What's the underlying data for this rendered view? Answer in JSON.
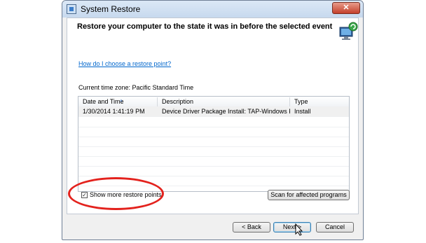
{
  "window": {
    "title": "System Restore",
    "close_glyph": "✕"
  },
  "header": {
    "text": "Restore your computer to the state it was in before the selected event"
  },
  "help_link": "How do I choose a restore point?",
  "timezone": "Current time zone: Pacific Standard Time",
  "table": {
    "columns": [
      "Date and Time",
      "Description",
      "Type"
    ],
    "rows": [
      {
        "date": "1/30/2014 1:41:19 PM",
        "description": "Device Driver Package Install: TAP-Windows Pro...",
        "type": "Install"
      }
    ]
  },
  "show_more": {
    "label": "Show more restore points",
    "checked": true,
    "check_glyph": "✓"
  },
  "buttons": {
    "scan": "Scan for affected programs",
    "back": "< Back",
    "next": "Next >",
    "cancel": "Cancel"
  },
  "colors": {
    "highlight_circle": "#e3221d",
    "link": "#0066cc"
  }
}
